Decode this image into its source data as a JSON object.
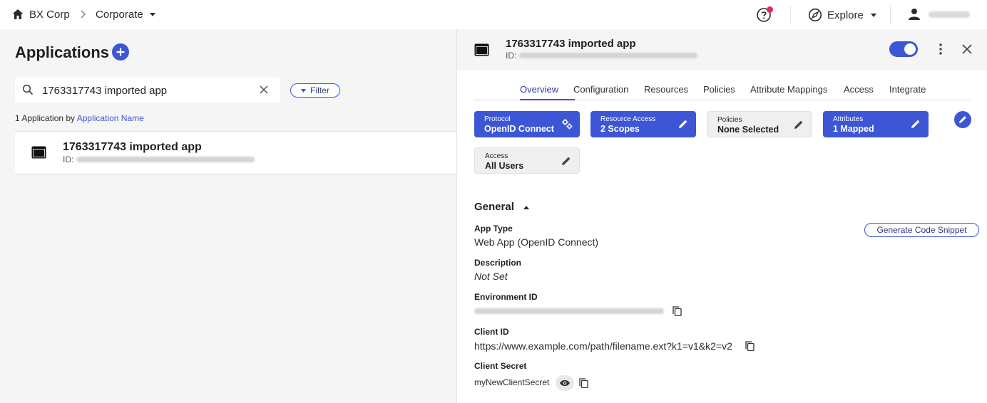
{
  "topbar": {
    "org_name": "BX Corp",
    "environment": "Corporate",
    "explore_label": "Explore"
  },
  "left": {
    "title": "Applications",
    "search": {
      "value": "1763317743 imported app"
    },
    "filter_label": "Filter",
    "result_count_prefix": "1 Application by",
    "result_count_link": "Application Name",
    "rows": [
      {
        "name": "1763317743 imported app",
        "id_label": "ID:"
      }
    ]
  },
  "detail": {
    "name": "1763317743 imported app",
    "id_label": "ID:",
    "enabled": true,
    "tabs": [
      "Overview",
      "Configuration",
      "Resources",
      "Policies",
      "Attribute Mappings",
      "Access",
      "Integrate"
    ],
    "active_tab": "Overview",
    "chips": [
      {
        "label": "Protocol",
        "value": "OpenID Connect",
        "style": "blue",
        "icon": "gears-icon"
      },
      {
        "label": "Resource Access",
        "value": "2 Scopes",
        "style": "blue",
        "icon": "pencil-icon"
      },
      {
        "label": "Policies",
        "value": "None Selected",
        "style": "grey",
        "icon": "pencil-icon"
      },
      {
        "label": "Attributes",
        "value": "1 Mapped",
        "style": "blue",
        "icon": "pencil-icon"
      },
      {
        "label": "Access",
        "value": "All Users",
        "style": "grey",
        "icon": "pencil-icon"
      }
    ],
    "general": {
      "title": "General",
      "generate_button": "Generate Code Snippet",
      "app_type_label": "App Type",
      "app_type_value": "Web App (OpenID Connect)",
      "description_label": "Description",
      "description_value": "Not Set",
      "environment_id_label": "Environment ID",
      "client_id_label": "Client ID",
      "client_id_value": "https://www.example.com/path/filename.ext?k1=v1&k2=v2",
      "client_secret_label": "Client Secret",
      "client_secret_value": "myNewClientSecret"
    }
  },
  "colors": {
    "accent": "#3c56d6",
    "notification": "#e6266c",
    "pane_bg": "#f5f5f5"
  }
}
